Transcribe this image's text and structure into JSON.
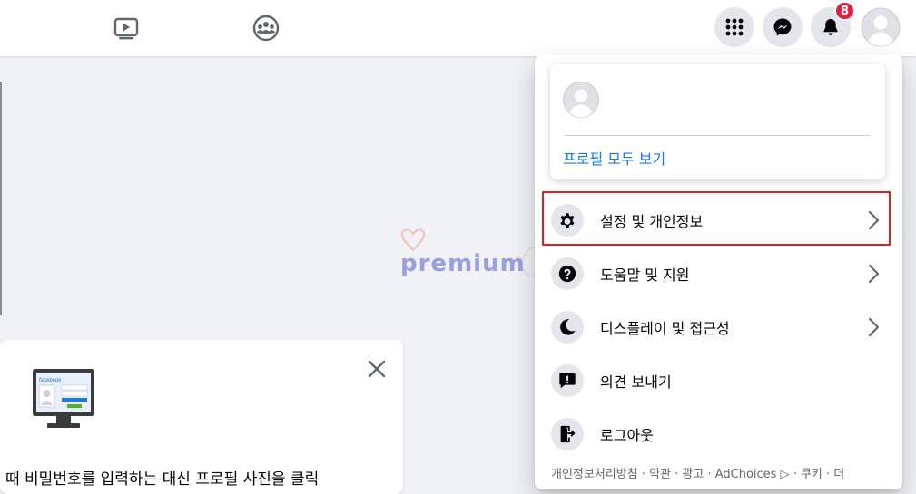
{
  "topbar": {
    "notifications_count": "8",
    "icons": [
      "video-icon",
      "groups-icon",
      "menu-grid-icon",
      "messenger-icon",
      "bell-icon",
      "avatar"
    ]
  },
  "card": {
    "text": "때 비밀번호를 입력하는 대신 프로필 사진을 클릭",
    "logo_text": "facebook"
  },
  "watermark": {
    "text": "premium"
  },
  "account_menu": {
    "profile_link": "프로필 모두 보기",
    "items": [
      {
        "label": "설정 및 개인정보",
        "icon": "gear-icon",
        "has_chevron": true,
        "highlighted": true
      },
      {
        "label": "도움말 및 지원",
        "icon": "question-icon",
        "has_chevron": true
      },
      {
        "label": "디스플레이 및 접근성",
        "icon": "moon-icon",
        "has_chevron": true
      },
      {
        "label": "의견 보내기",
        "icon": "feedback-icon",
        "has_chevron": false
      },
      {
        "label": "로그아웃",
        "icon": "logout-icon",
        "has_chevron": false
      }
    ],
    "footer": "개인정보처리방침 · 약관 · 광고 · AdChoices ▷ · 쿠키 · 더"
  },
  "colors": {
    "accent": "#1877f2",
    "badge": "#e41e3f",
    "highlight_border": "#e02020"
  }
}
